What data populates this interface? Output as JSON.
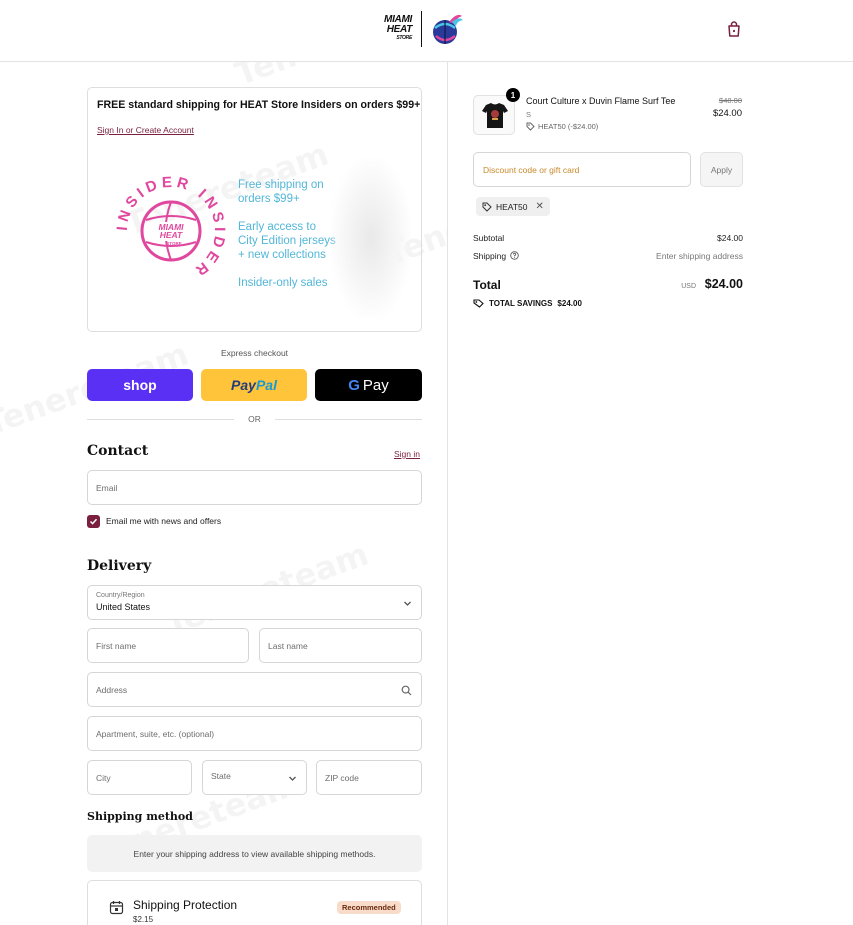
{
  "header": {
    "logo_line1": "MIAMI",
    "logo_line2": "HEAT",
    "logo_line3": "STORE",
    "cart_icon": "shopping-bag-icon"
  },
  "promo": {
    "title": "FREE standard shipping for HEAT Store Insiders on orders $99+ !",
    "link": "Sign In or Create Account",
    "badge_ring_text": "INSIDER INSIDER",
    "badge_center_line1": "MIAMI",
    "badge_center_line2": "HEAT",
    "badge_center_line3": "STORE",
    "benefits": [
      "Free shipping on",
      "orders $99+",
      "Early access to",
      "City Edition jerseys",
      "+ new collections",
      "Insider-only sales"
    ]
  },
  "express": {
    "label": "Express checkout",
    "shop": "shop",
    "paypal_a": "Pay",
    "paypal_b": "Pal",
    "gpay": "Pay",
    "or": "OR"
  },
  "contact": {
    "heading": "Contact",
    "sign_in": "Sign in",
    "email_placeholder": "Email",
    "newsletter_label": "Email me with news and offers",
    "newsletter_checked": true
  },
  "delivery": {
    "heading": "Delivery",
    "country_label": "Country/Region",
    "country_value": "United States",
    "first_name": "First name",
    "last_name": "Last name",
    "address": "Address",
    "apartment": "Apartment, suite, etc. (optional)",
    "city": "City",
    "state": "State",
    "zip": "ZIP code"
  },
  "shipping": {
    "heading": "Shipping method",
    "info": "Enter your shipping address to view available shipping methods."
  },
  "protection": {
    "title": "Shipping Protection",
    "price": "$2.15",
    "badge": "Recommended"
  },
  "summary": {
    "product": {
      "qty": "1",
      "name": "Court Culture x Duvin Flame Surf Tee",
      "variant": "S",
      "discount": "HEAT50 (-$24.00)",
      "old_price": "$48.00",
      "price": "$24.00"
    },
    "discount_placeholder": "Discount code or gift card",
    "apply": "Apply",
    "code_chip": "HEAT50",
    "subtotal_label": "Subtotal",
    "subtotal_value": "$24.00",
    "shipping_label": "Shipping",
    "shipping_value": "Enter shipping address",
    "total_label": "Total",
    "total_currency": "USD",
    "total_value": "$24.00",
    "savings_label": "TOTAL SAVINGS",
    "savings_value": "$24.00"
  },
  "watermark": "Tenereteam",
  "colors": {
    "accent": "#7a1f3d",
    "shop": "#5a31f4",
    "paypal": "#ffc439",
    "benefit_text": "#52b6d8",
    "badge_pink": "#e0479e"
  }
}
